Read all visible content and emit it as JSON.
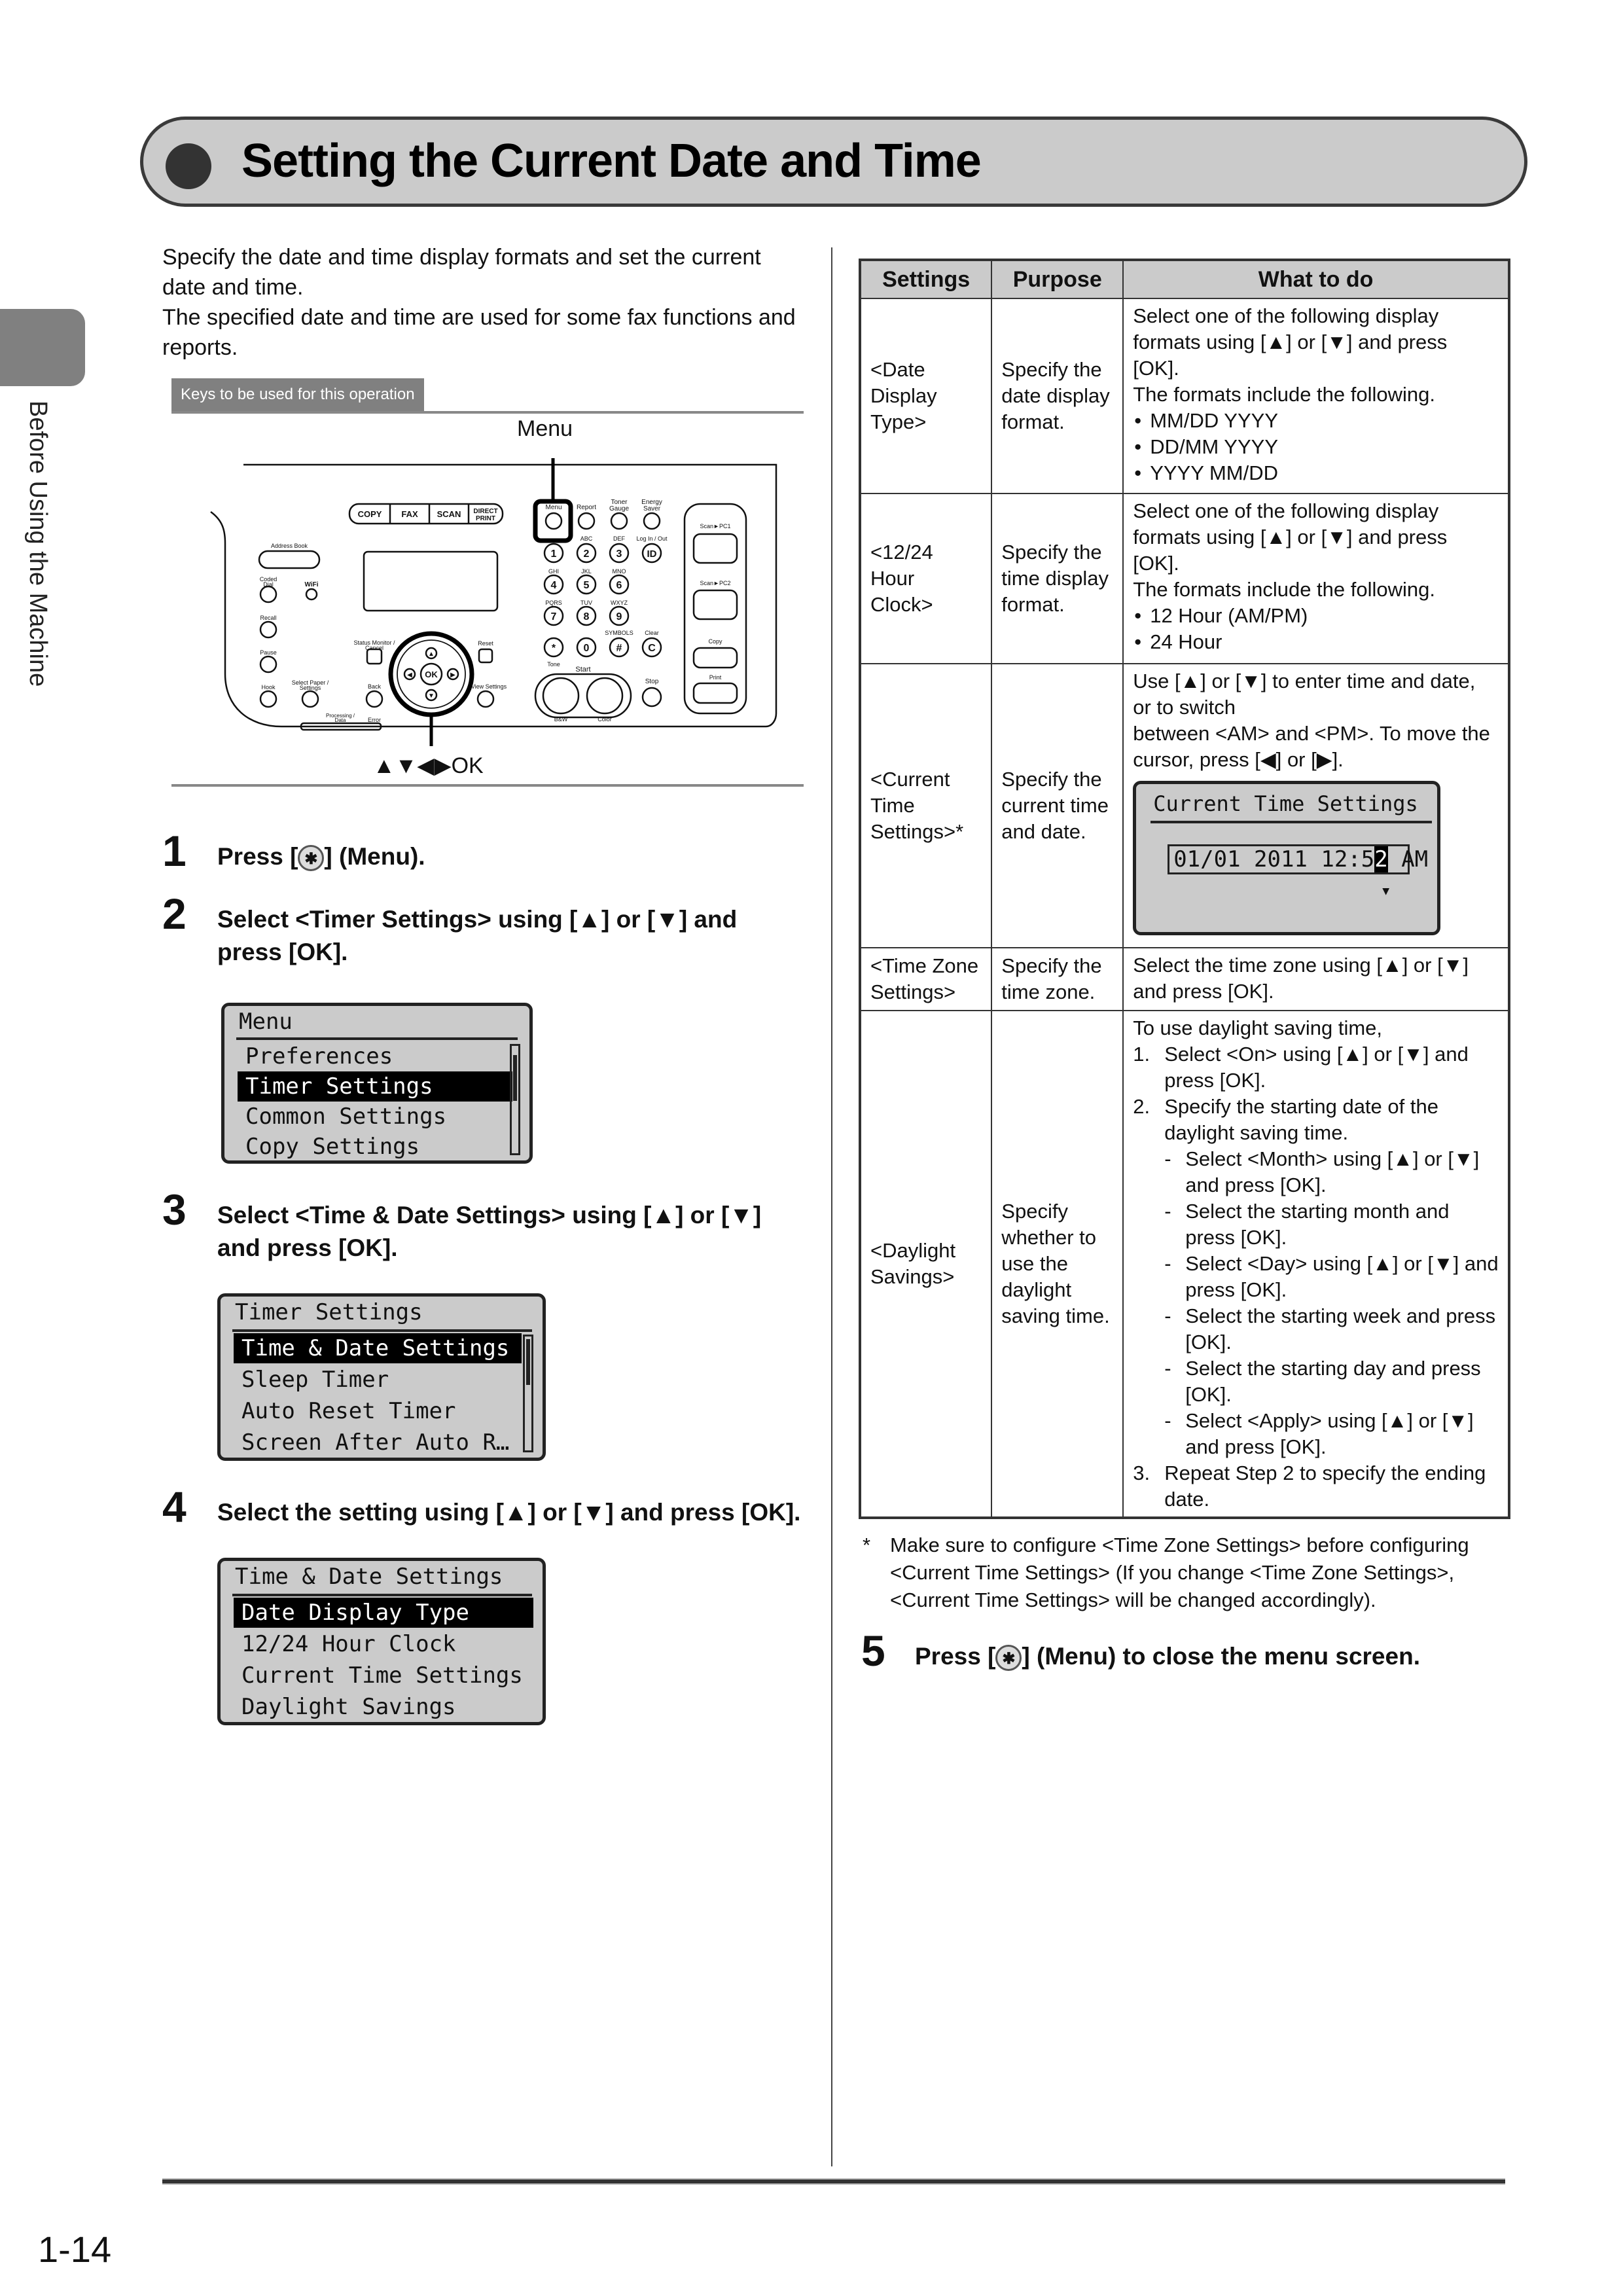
{
  "title": "Setting the Current Date and Time",
  "side_tab": "Before Using the Machine",
  "intro": [
    "Specify the date and time display formats and set the current date and time.",
    "The specified date and time are used for some fax functions and reports."
  ],
  "keys_label": "Keys to be used for this operation",
  "panel": {
    "menu_callout": "Menu",
    "arrows_callout": "▲▼◀▶OK",
    "mode_buttons": [
      "COPY",
      "FAX",
      "SCAN",
      "DIRECT PRINT"
    ],
    "top_keys": [
      "Menu",
      "Report",
      "Toner Gauge",
      "Energy Saver"
    ],
    "keypad": [
      {
        "key": "1",
        "letters": ""
      },
      {
        "key": "2",
        "letters": "ABC"
      },
      {
        "key": "3",
        "letters": "DEF"
      },
      {
        "key": "ID",
        "letters": "Log In / Out"
      },
      {
        "key": "4",
        "letters": "GHI"
      },
      {
        "key": "5",
        "letters": "JKL"
      },
      {
        "key": "6",
        "letters": "MNO"
      },
      {
        "key": "7",
        "letters": "PQRS"
      },
      {
        "key": "8",
        "letters": "TUV"
      },
      {
        "key": "9",
        "letters": "WXYZ"
      },
      {
        "key": "*",
        "letters": "Tone"
      },
      {
        "key": "0",
        "letters": ""
      },
      {
        "key": "#",
        "letters": "SYMBOLS"
      },
      {
        "key": "C",
        "letters": "Clear"
      }
    ],
    "left_keys": [
      "Address Book",
      "Coded Dial",
      "Wi Fi",
      "Recall",
      "Pause",
      "Hook",
      "Select Paper / Settings",
      "Processing / Data",
      "Error"
    ],
    "center_keys": [
      "Status Monitor / Cancel",
      "Back",
      "Reset",
      "View Settings",
      "OK"
    ],
    "start_label": "Start",
    "bw_label": "B&W",
    "color_label": "Color",
    "stop_label": "Stop",
    "right_keys": [
      "Scan►PC1",
      "Scan►PC2",
      "Copy",
      "Print"
    ]
  },
  "steps": [
    {
      "num": "1",
      "text_before": "Press [",
      "text_after": "] (Menu)."
    },
    {
      "num": "2",
      "text": "Select <Timer Settings> using [▲] or [▼] and press [OK]."
    },
    {
      "num": "3",
      "text": "Select <Time & Date Settings> using [▲] or [▼] and press [OK]."
    },
    {
      "num": "4",
      "text": "Select the setting using [▲] or [▼] and press [OK]."
    },
    {
      "num": "5",
      "text_before": "Press [",
      "text_after": "] (Menu) to close the menu screen."
    }
  ],
  "screens": {
    "menu": {
      "title": "Menu",
      "items": [
        "Preferences",
        "Timer Settings",
        "Common Settings",
        "Copy Settings"
      ],
      "selected": 1
    },
    "timer": {
      "title": "Timer Settings",
      "items": [
        "Time & Date Settings",
        "Sleep Timer",
        "Auto Reset Timer",
        "Screen After Auto R…"
      ],
      "selected": 0
    },
    "timedate": {
      "title": "Time & Date Settings",
      "items": [
        "Date Display Type",
        "12/24 Hour Clock",
        "Current Time Settings",
        "Daylight Savings"
      ],
      "selected": 0
    },
    "current_time": {
      "title": "Current Time Settings",
      "value_before": "01/01 2011 12:5",
      "value_cursor": "2",
      "value_after": " AM",
      "down_arrow": "▼"
    }
  },
  "table": {
    "headers": [
      "Settings",
      "Purpose",
      "What to do"
    ],
    "rows": [
      {
        "setting": "<Date Display Type>",
        "purpose": "Specify the date display format.",
        "what_intro": "Select one of the following display formats using [▲] or [▼] and press [OK].",
        "what_note": "The formats include the following.",
        "bullets": [
          "MM/DD YYYY",
          "DD/MM YYYY",
          "YYYY MM/DD"
        ]
      },
      {
        "setting": "<12/24 Hour Clock>",
        "purpose": "Specify the time display format.",
        "what_intro": "Select one of the following display formats using [▲] or [▼] and press [OK].",
        "what_note": "The formats include the following.",
        "bullets": [
          "12 Hour (AM/PM)",
          "24 Hour"
        ]
      },
      {
        "setting": "<Current Time Settings>*",
        "purpose": "Specify the current time and date.",
        "what_line1": "Use [▲] or [▼] to enter time and date, or to switch",
        "what_line2": "between <AM> and <PM>. To move the cursor, press [◀] or [▶]."
      },
      {
        "setting": "<Time Zone Settings>",
        "purpose": "Specify the time zone.",
        "what": "Select the time zone using [▲] or [▼] and press [OK]."
      },
      {
        "setting": "<Daylight Savings>",
        "purpose": "Specify whether to use the daylight saving time.",
        "what_intro": "To use daylight saving time,",
        "steps": [
          {
            "num": "1.",
            "text": "Select <On> using [▲] or [▼] and press [OK]."
          },
          {
            "num": "2.",
            "text": "Specify the starting date of the daylight saving time."
          }
        ],
        "substeps": [
          "Select <Month> using [▲] or [▼] and press [OK].",
          "Select the starting month and press [OK].",
          "Select <Day> using [▲] or [▼] and press [OK].",
          "Select the starting week and press [OK].",
          "Select the starting day and press [OK].",
          "Select <Apply> using [▲] or [▼] and press [OK]."
        ],
        "final_step": {
          "num": "3.",
          "text": "Repeat Step 2 to specify the ending date."
        }
      }
    ]
  },
  "footnote": {
    "mark": "*",
    "text": "Make sure to configure <Time Zone Settings> before configuring <Current Time Settings> (If you change <Time Zone Settings>, <Current Time Settings> will be changed accordingly)."
  },
  "page_number": "1-14"
}
